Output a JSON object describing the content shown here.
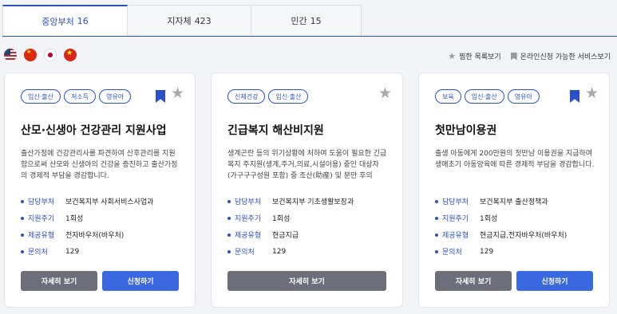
{
  "tabs": [
    {
      "label": "중앙부처",
      "count": "16"
    },
    {
      "label": "지자체",
      "count": "423"
    },
    {
      "label": "민간",
      "count": "15"
    }
  ],
  "legend": {
    "favorite": "찜한 목록보기",
    "online": "온라인신청 가능한 서비스보기"
  },
  "colors": {
    "accent": "#2a50c8",
    "button_blue": "#3a68e0",
    "button_grey": "#6c6e7a"
  },
  "labels": {
    "dept": "담당부처",
    "cycle": "지원주기",
    "type": "제공유형",
    "contact": "문의처",
    "detail": "자세히 보기",
    "apply": "신청하기"
  },
  "cards": [
    {
      "tags": [
        "임신·출산",
        "저소득",
        "영유아"
      ],
      "title": "산모·신생아 건강관리 지원사업",
      "desc": "출산가정에 건강관리사를 파견하여 산후관리를 지원함으로써 산모와 신생아의 건강을 증진하고 출산가정의 경제적 부담을 경감합니다.",
      "dept": "보건복지부 사회서비스사업과",
      "cycle": "1회성",
      "type": "전자바우처(바우처)",
      "contact": "129"
    },
    {
      "tags": [
        "신체건강",
        "임신·출산"
      ],
      "title": "긴급복지 해산비지원",
      "desc": "생계곤란 등의 위기상황에 처하여 도움이 필요한 긴급복지 주지원(생계,주거,의료,시설이용) 중인 대상자(가구구구성원 포함) 중 조산(助産) 및 분만 후의",
      "dept": "보건복지부 기초생활보장과",
      "cycle": "1회성",
      "type": "현금지급",
      "contact": "129"
    },
    {
      "tags": [
        "보육",
        "임신·출산",
        "영유아"
      ],
      "title": "첫만남이용권",
      "desc": "출생 아동에게 200만원의 첫만남 이용권을 지급하여 생애초기 아동양육에 따른 경제적 부담을 경감합니다.",
      "dept": "보건복지부 출산정책과",
      "cycle": "1회성",
      "type": "현금지급,전자바우처(바우처)",
      "contact": "129"
    }
  ]
}
